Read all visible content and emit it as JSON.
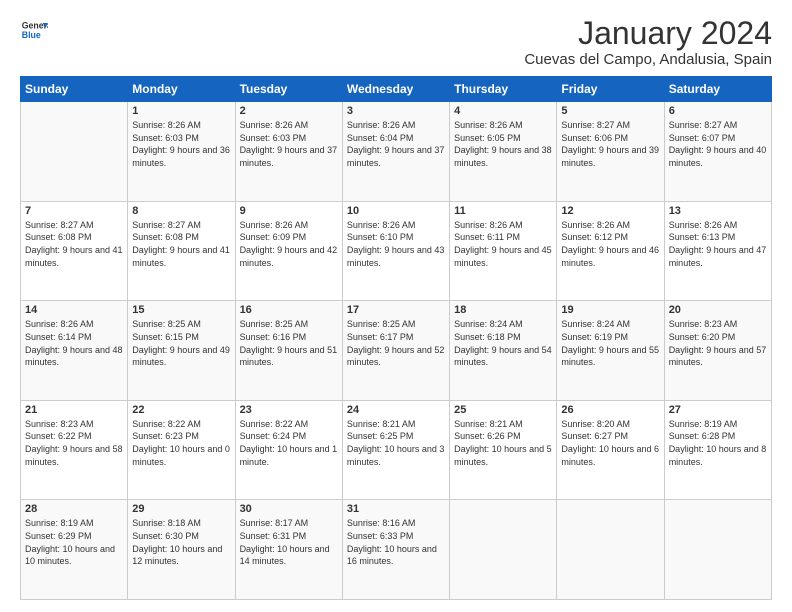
{
  "logo": {
    "text_general": "General",
    "text_blue": "Blue"
  },
  "header": {
    "month_year": "January 2024",
    "location": "Cuevas del Campo, Andalusia, Spain"
  },
  "days_of_week": [
    "Sunday",
    "Monday",
    "Tuesday",
    "Wednesday",
    "Thursday",
    "Friday",
    "Saturday"
  ],
  "weeks": [
    [
      {
        "day": "",
        "sunrise": "",
        "sunset": "",
        "daylight": ""
      },
      {
        "day": "1",
        "sunrise": "Sunrise: 8:26 AM",
        "sunset": "Sunset: 6:03 PM",
        "daylight": "Daylight: 9 hours and 36 minutes."
      },
      {
        "day": "2",
        "sunrise": "Sunrise: 8:26 AM",
        "sunset": "Sunset: 6:03 PM",
        "daylight": "Daylight: 9 hours and 37 minutes."
      },
      {
        "day": "3",
        "sunrise": "Sunrise: 8:26 AM",
        "sunset": "Sunset: 6:04 PM",
        "daylight": "Daylight: 9 hours and 37 minutes."
      },
      {
        "day": "4",
        "sunrise": "Sunrise: 8:26 AM",
        "sunset": "Sunset: 6:05 PM",
        "daylight": "Daylight: 9 hours and 38 minutes."
      },
      {
        "day": "5",
        "sunrise": "Sunrise: 8:27 AM",
        "sunset": "Sunset: 6:06 PM",
        "daylight": "Daylight: 9 hours and 39 minutes."
      },
      {
        "day": "6",
        "sunrise": "Sunrise: 8:27 AM",
        "sunset": "Sunset: 6:07 PM",
        "daylight": "Daylight: 9 hours and 40 minutes."
      }
    ],
    [
      {
        "day": "7",
        "sunrise": "Sunrise: 8:27 AM",
        "sunset": "Sunset: 6:08 PM",
        "daylight": "Daylight: 9 hours and 41 minutes."
      },
      {
        "day": "8",
        "sunrise": "Sunrise: 8:27 AM",
        "sunset": "Sunset: 6:08 PM",
        "daylight": "Daylight: 9 hours and 41 minutes."
      },
      {
        "day": "9",
        "sunrise": "Sunrise: 8:26 AM",
        "sunset": "Sunset: 6:09 PM",
        "daylight": "Daylight: 9 hours and 42 minutes."
      },
      {
        "day": "10",
        "sunrise": "Sunrise: 8:26 AM",
        "sunset": "Sunset: 6:10 PM",
        "daylight": "Daylight: 9 hours and 43 minutes."
      },
      {
        "day": "11",
        "sunrise": "Sunrise: 8:26 AM",
        "sunset": "Sunset: 6:11 PM",
        "daylight": "Daylight: 9 hours and 45 minutes."
      },
      {
        "day": "12",
        "sunrise": "Sunrise: 8:26 AM",
        "sunset": "Sunset: 6:12 PM",
        "daylight": "Daylight: 9 hours and 46 minutes."
      },
      {
        "day": "13",
        "sunrise": "Sunrise: 8:26 AM",
        "sunset": "Sunset: 6:13 PM",
        "daylight": "Daylight: 9 hours and 47 minutes."
      }
    ],
    [
      {
        "day": "14",
        "sunrise": "Sunrise: 8:26 AM",
        "sunset": "Sunset: 6:14 PM",
        "daylight": "Daylight: 9 hours and 48 minutes."
      },
      {
        "day": "15",
        "sunrise": "Sunrise: 8:25 AM",
        "sunset": "Sunset: 6:15 PM",
        "daylight": "Daylight: 9 hours and 49 minutes."
      },
      {
        "day": "16",
        "sunrise": "Sunrise: 8:25 AM",
        "sunset": "Sunset: 6:16 PM",
        "daylight": "Daylight: 9 hours and 51 minutes."
      },
      {
        "day": "17",
        "sunrise": "Sunrise: 8:25 AM",
        "sunset": "Sunset: 6:17 PM",
        "daylight": "Daylight: 9 hours and 52 minutes."
      },
      {
        "day": "18",
        "sunrise": "Sunrise: 8:24 AM",
        "sunset": "Sunset: 6:18 PM",
        "daylight": "Daylight: 9 hours and 54 minutes."
      },
      {
        "day": "19",
        "sunrise": "Sunrise: 8:24 AM",
        "sunset": "Sunset: 6:19 PM",
        "daylight": "Daylight: 9 hours and 55 minutes."
      },
      {
        "day": "20",
        "sunrise": "Sunrise: 8:23 AM",
        "sunset": "Sunset: 6:20 PM",
        "daylight": "Daylight: 9 hours and 57 minutes."
      }
    ],
    [
      {
        "day": "21",
        "sunrise": "Sunrise: 8:23 AM",
        "sunset": "Sunset: 6:22 PM",
        "daylight": "Daylight: 9 hours and 58 minutes."
      },
      {
        "day": "22",
        "sunrise": "Sunrise: 8:22 AM",
        "sunset": "Sunset: 6:23 PM",
        "daylight": "Daylight: 10 hours and 0 minutes."
      },
      {
        "day": "23",
        "sunrise": "Sunrise: 8:22 AM",
        "sunset": "Sunset: 6:24 PM",
        "daylight": "Daylight: 10 hours and 1 minute."
      },
      {
        "day": "24",
        "sunrise": "Sunrise: 8:21 AM",
        "sunset": "Sunset: 6:25 PM",
        "daylight": "Daylight: 10 hours and 3 minutes."
      },
      {
        "day": "25",
        "sunrise": "Sunrise: 8:21 AM",
        "sunset": "Sunset: 6:26 PM",
        "daylight": "Daylight: 10 hours and 5 minutes."
      },
      {
        "day": "26",
        "sunrise": "Sunrise: 8:20 AM",
        "sunset": "Sunset: 6:27 PM",
        "daylight": "Daylight: 10 hours and 6 minutes."
      },
      {
        "day": "27",
        "sunrise": "Sunrise: 8:19 AM",
        "sunset": "Sunset: 6:28 PM",
        "daylight": "Daylight: 10 hours and 8 minutes."
      }
    ],
    [
      {
        "day": "28",
        "sunrise": "Sunrise: 8:19 AM",
        "sunset": "Sunset: 6:29 PM",
        "daylight": "Daylight: 10 hours and 10 minutes."
      },
      {
        "day": "29",
        "sunrise": "Sunrise: 8:18 AM",
        "sunset": "Sunset: 6:30 PM",
        "daylight": "Daylight: 10 hours and 12 minutes."
      },
      {
        "day": "30",
        "sunrise": "Sunrise: 8:17 AM",
        "sunset": "Sunset: 6:31 PM",
        "daylight": "Daylight: 10 hours and 14 minutes."
      },
      {
        "day": "31",
        "sunrise": "Sunrise: 8:16 AM",
        "sunset": "Sunset: 6:33 PM",
        "daylight": "Daylight: 10 hours and 16 minutes."
      },
      {
        "day": "",
        "sunrise": "",
        "sunset": "",
        "daylight": ""
      },
      {
        "day": "",
        "sunrise": "",
        "sunset": "",
        "daylight": ""
      },
      {
        "day": "",
        "sunrise": "",
        "sunset": "",
        "daylight": ""
      }
    ]
  ]
}
